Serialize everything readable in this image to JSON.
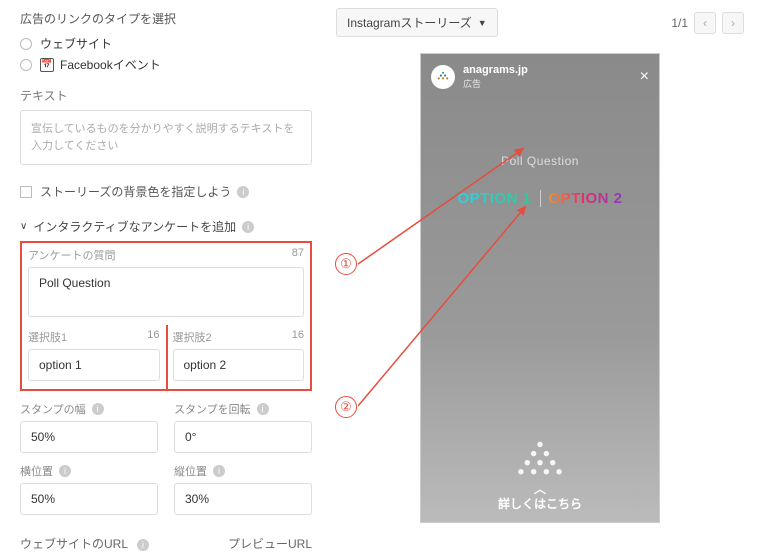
{
  "leftPanel": {
    "linkTypeTitle": "広告のリンクのタイプを選択",
    "radio1": "ウェブサイト",
    "radio2": "Facebookイベント",
    "textLabel": "テキスト",
    "textPlaceholder": "宣伝しているものを分かりやすく説明するテキストを入力してください",
    "bgCheckbox": "ストーリーズの背景色を指定しよう",
    "pollSection": "インタラクティブなアンケートを追加",
    "poll": {
      "questionLabel": "アンケートの質問",
      "questionCount": "87",
      "questionValue": "Poll Question",
      "opt1Label": "選択肢1",
      "opt1Count": "16",
      "opt1Value": "option 1",
      "opt2Label": "選択肢2",
      "opt2Count": "16",
      "opt2Value": "option 2"
    },
    "stampWidth": {
      "label": "スタンプの幅",
      "value": "50%"
    },
    "stampRotate": {
      "label": "スタンプを回転",
      "value": "0°"
    },
    "posX": {
      "label": "横位置",
      "value": "50%"
    },
    "posY": {
      "label": "縦位置",
      "value": "30%"
    },
    "websiteUrl": "ウェブサイトのURL",
    "previewUrl": "プレビューURL"
  },
  "annotations": {
    "n1": "①",
    "n2": "②"
  },
  "rightPanel": {
    "selector": "Instagramストーリーズ",
    "page": "1/1",
    "story": {
      "account": "anagrams.jp",
      "sponsored": "広告",
      "pollQuestion": "Poll Question",
      "option1": "OPTION 1",
      "option2": "OPTION 2",
      "cta": "詳しくはこちら"
    }
  }
}
